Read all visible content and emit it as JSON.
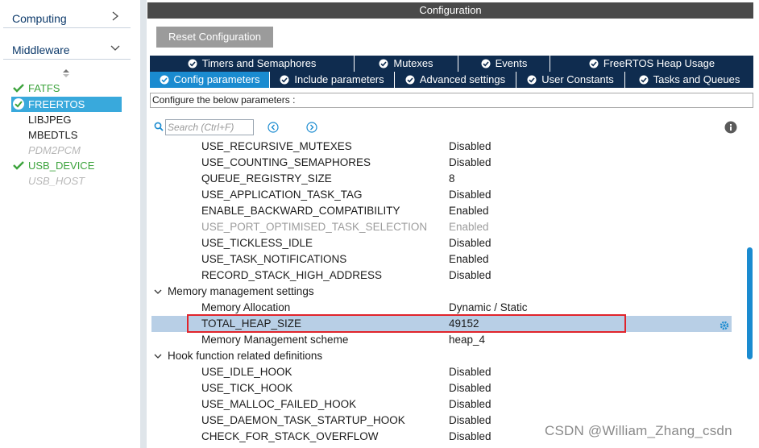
{
  "left": {
    "categories": [
      {
        "label": "Computing",
        "state": "collapsed"
      },
      {
        "label": "Middleware",
        "state": "expanded"
      }
    ],
    "middleware_items": [
      {
        "label": "FATFS",
        "status": "enabled"
      },
      {
        "label": "FREERTOS",
        "status": "selected"
      },
      {
        "label": "LIBJPEG",
        "status": "plain"
      },
      {
        "label": "MBEDTLS",
        "status": "plain"
      },
      {
        "label": "PDM2PCM",
        "status": "disabled"
      },
      {
        "label": "USB_DEVICE",
        "status": "enabled"
      },
      {
        "label": "USB_HOST",
        "status": "disabled"
      }
    ]
  },
  "config": {
    "title": "Configuration",
    "reset_label": "Reset Configuration",
    "tabs_row1": [
      {
        "label": "Timers and Semaphores"
      },
      {
        "label": "Mutexes"
      },
      {
        "label": "Events"
      },
      {
        "label": "FreeRTOS Heap Usage"
      }
    ],
    "tabs_row2": [
      {
        "label": "Config parameters",
        "active": true
      },
      {
        "label": "Include parameters"
      },
      {
        "label": "Advanced settings"
      },
      {
        "label": "User Constants"
      },
      {
        "label": "Tasks and Queues"
      }
    ],
    "configure_label": "Configure the below parameters :",
    "search_placeholder": "Search (Ctrl+F)"
  },
  "params_top": [
    {
      "name": "USE_RECURSIVE_MUTEXES",
      "value": "Disabled"
    },
    {
      "name": "USE_COUNTING_SEMAPHORES",
      "value": "Disabled"
    },
    {
      "name": "QUEUE_REGISTRY_SIZE",
      "value": "8"
    },
    {
      "name": "USE_APPLICATION_TASK_TAG",
      "value": "Disabled"
    },
    {
      "name": "ENABLE_BACKWARD_COMPATIBILITY",
      "value": "Enabled"
    },
    {
      "name": "USE_PORT_OPTIMISED_TASK_SELECTION",
      "value": "Enabled",
      "disabled": true
    },
    {
      "name": "USE_TICKLESS_IDLE",
      "value": "Disabled"
    },
    {
      "name": "USE_TASK_NOTIFICATIONS",
      "value": "Enabled"
    },
    {
      "name": "RECORD_STACK_HIGH_ADDRESS",
      "value": "Disabled"
    }
  ],
  "group_memory": {
    "title": "Memory management settings",
    "params": [
      {
        "name": "Memory Allocation",
        "value": "Dynamic / Static"
      },
      {
        "name": "TOTAL_HEAP_SIZE",
        "value": "49152",
        "selected": true
      },
      {
        "name": "Memory Management scheme",
        "value": "heap_4"
      }
    ]
  },
  "group_hook": {
    "title": "Hook function related definitions",
    "params": [
      {
        "name": "USE_IDLE_HOOK",
        "value": "Disabled"
      },
      {
        "name": "USE_TICK_HOOK",
        "value": "Disabled"
      },
      {
        "name": "USE_MALLOC_FAILED_HOOK",
        "value": "Disabled"
      },
      {
        "name": "USE_DAEMON_TASK_STARTUP_HOOK",
        "value": "Disabled"
      },
      {
        "name": "CHECK_FOR_STACK_OVERFLOW",
        "value": "Disabled"
      }
    ]
  },
  "watermark": "CSDN @William_Zhang_csdn",
  "colors": {
    "accent": "#1a8bd0",
    "tab_dark": "#0f2c4f",
    "enabled_green": "#3ca33c",
    "highlight_red": "#e0242b",
    "selected_row": "#b8cfe6"
  }
}
